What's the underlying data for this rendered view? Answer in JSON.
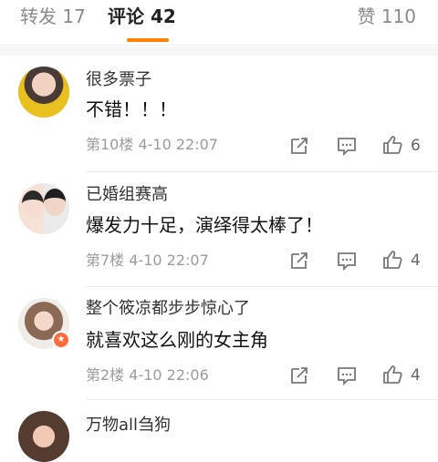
{
  "tabs": {
    "repost": "转发 17",
    "comments": "评论 42",
    "likes": "赞 110"
  },
  "comments": [
    {
      "name": "很多票子",
      "text": "不错！！！",
      "meta": "第10楼  4-10 22:07",
      "likes": "6"
    },
    {
      "name": "已婚组赛高",
      "text": "爆发力十足，演绎得太棒了！",
      "meta": "第7楼  4-10 22:07",
      "likes": "4"
    },
    {
      "name": "整个筱凉都步步惊心了",
      "text": "就喜欢这么刚的女主角",
      "meta": "第2楼  4-10 22:06",
      "likes": "4"
    },
    {
      "name": "万物all刍狗"
    }
  ],
  "colors": {
    "accent": "#ff8200",
    "badge": "#ff6a3d",
    "meta": "#9b9b9b"
  },
  "icons": {
    "share": "share-icon",
    "reply": "comment-icon",
    "like": "thumbs-up-icon"
  }
}
